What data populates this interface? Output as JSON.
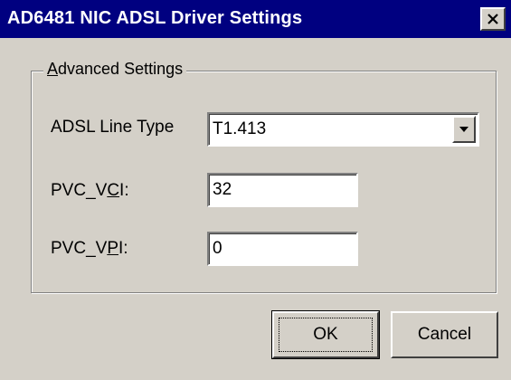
{
  "window": {
    "title": "AD6481 NIC ADSL Driver Settings"
  },
  "group": {
    "label_accel": "A",
    "label_rest": "dvanced Settings"
  },
  "fields": {
    "line_type": {
      "label": "ADSL Line Type",
      "value": "T1.413"
    },
    "vci": {
      "label_pre": "PVC_V",
      "label_accel": "C",
      "label_post": "I:",
      "value": "32"
    },
    "vpi": {
      "label_pre": "PVC_V",
      "label_accel": "P",
      "label_post": "I:",
      "value": "0"
    }
  },
  "buttons": {
    "ok": "OK",
    "cancel": "Cancel"
  },
  "icons": {
    "close": "close-icon",
    "dropdown": "chevron-down-icon"
  },
  "colors": {
    "titlebar": "#000080",
    "face": "#d4d0c8"
  }
}
